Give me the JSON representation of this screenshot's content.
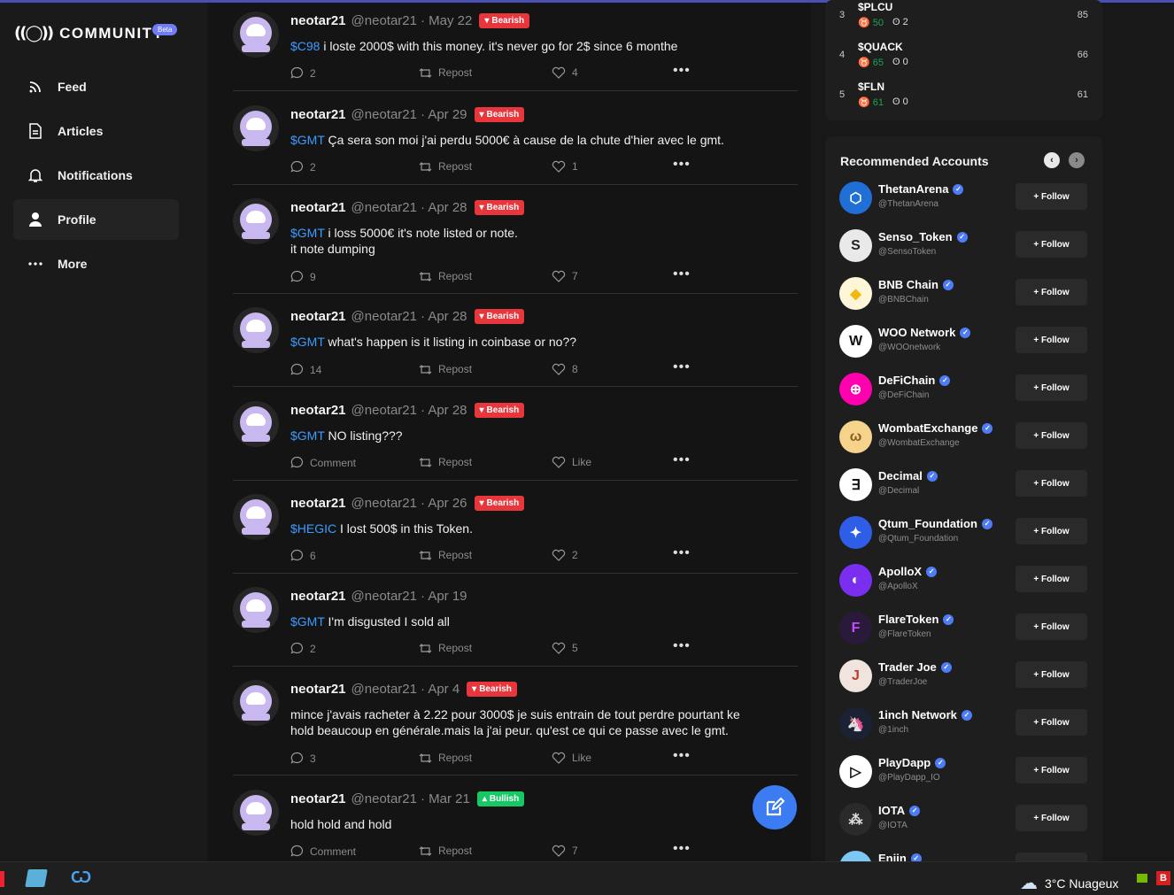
{
  "app": {
    "logo_text": "COMMUNITY",
    "beta_label": "Beta"
  },
  "sidebar": {
    "items": [
      {
        "label": "Feed",
        "icon": "rss-icon"
      },
      {
        "label": "Articles",
        "icon": "document-icon"
      },
      {
        "label": "Notifications",
        "icon": "bell-icon"
      },
      {
        "label": "Profile",
        "icon": "user-icon"
      },
      {
        "label": "More",
        "icon": "more-icon"
      }
    ],
    "active": "Profile"
  },
  "posts": [
    {
      "user": "neotar21",
      "handle": "@neotar21",
      "date": "· May 22",
      "sentiment": "Bearish",
      "ticker": "$C98",
      "text": " i loste 2000$ with this money. it's never go for 2$ since 6 monthe",
      "comments": "2",
      "repost": "Repost",
      "likes": "4"
    },
    {
      "user": "neotar21",
      "handle": "@neotar21",
      "date": "· Apr 29",
      "sentiment": "Bearish",
      "ticker": "$GMT",
      "text": " Ça sera son moi j'ai perdu 5000€ à cause de la chute d'hier avec le gmt.",
      "comments": "2",
      "repost": "Repost",
      "likes": "1"
    },
    {
      "user": "neotar21",
      "handle": "@neotar21",
      "date": "· Apr 28",
      "sentiment": "Bearish",
      "ticker": "$GMT",
      "text": " i loss 5000€ it's note listed or note.",
      "text2": "it note dumping",
      "comments": "9",
      "repost": "Repost",
      "likes": "7"
    },
    {
      "user": "neotar21",
      "handle": "@neotar21",
      "date": "· Apr 28",
      "sentiment": "Bearish",
      "ticker": "$GMT",
      "text": " what's happen is it listing in coinbase or no??",
      "comments": "14",
      "repost": "Repost",
      "likes": "8"
    },
    {
      "user": "neotar21",
      "handle": "@neotar21",
      "date": "· Apr 28",
      "sentiment": "Bearish",
      "ticker": "$GMT",
      "text": " NO listing???",
      "comments": "Comment",
      "repost": "Repost",
      "likes": "Like"
    },
    {
      "user": "neotar21",
      "handle": "@neotar21",
      "date": "· Apr 26",
      "sentiment": "Bearish",
      "ticker": "$HEGIC",
      "text": " I lost 500$ in this Token.",
      "comments": "6",
      "repost": "Repost",
      "likes": "2"
    },
    {
      "user": "neotar21",
      "handle": "@neotar21",
      "date": "· Apr 19",
      "sentiment": "",
      "ticker": "$GMT",
      "text": " I'm disgusted I sold all",
      "comments": "2",
      "repost": "Repost",
      "likes": "5"
    },
    {
      "user": "neotar21",
      "handle": "@neotar21",
      "date": "· Apr 4",
      "sentiment": "Bearish",
      "ticker": "",
      "text": "mince j'avais racheter à 2.22 pour 3000$ je suis entrain de tout perdre pourtant ke",
      "text2": "hold beaucoup en générale.mais la j'ai peur. qu'est ce qui ce passe avec le gmt.",
      "comments": "3",
      "repost": "Repost",
      "likes": "Like"
    },
    {
      "user": "neotar21",
      "handle": "@neotar21",
      "date": "· Mar 21",
      "sentiment": "Bullish",
      "ticker": "",
      "text": "hold hold and hold",
      "comments": "Comment",
      "repost": "Repost",
      "likes": "7"
    }
  ],
  "rankings": [
    {
      "rank": "3",
      "symbol": "$PLCU",
      "bull": "50",
      "bear": "2",
      "score": "85"
    },
    {
      "rank": "4",
      "symbol": "$QUACK",
      "bull": "65",
      "bear": "0",
      "score": "66"
    },
    {
      "rank": "5",
      "symbol": "$FLN",
      "bull": "61",
      "bear": "0",
      "score": "61"
    }
  ],
  "recommended": {
    "title": "Recommended Accounts",
    "follow_label": "+ Follow",
    "accounts": [
      {
        "name": "ThetanArena",
        "handle": "@ThetanArena",
        "color": "#1f6fd6"
      },
      {
        "name": "Senso_Token",
        "handle": "@SensoToken",
        "color": "#e9e9e9"
      },
      {
        "name": "BNB Chain",
        "handle": "@BNBChain",
        "color": "#fff6da"
      },
      {
        "name": "WOO Network",
        "handle": "@WOOnetwork",
        "color": "#ffffff"
      },
      {
        "name": "DeFiChain",
        "handle": "@DeFiChain",
        "color": "#ff00af"
      },
      {
        "name": "WombatExchange",
        "handle": "@WombatExchange",
        "color": "#f6d38a"
      },
      {
        "name": "Decimal",
        "handle": "@Decimal",
        "color": "#ffffff"
      },
      {
        "name": "Qtum_Foundation",
        "handle": "@Qtum_Foundation",
        "color": "#2e5ee8"
      },
      {
        "name": "ApolloX",
        "handle": "@ApolloX",
        "color": "#7a2ff0"
      },
      {
        "name": "FlareToken",
        "handle": "@FlareToken",
        "color": "#2a1a3a"
      },
      {
        "name": "Trader Joe",
        "handle": "@TraderJoe",
        "color": "#f1e4df"
      },
      {
        "name": "1inch Network",
        "handle": "@1inch",
        "color": "#1b2233"
      },
      {
        "name": "PlayDapp",
        "handle": "@PlayDapp_IO",
        "color": "#ffffff"
      },
      {
        "name": "IOTA",
        "handle": "@IOTA",
        "color": "#2a2a2a"
      },
      {
        "name": "Enjin",
        "handle": "",
        "color": "#7cc8f5"
      }
    ]
  },
  "taskbar": {
    "weather": "3°C  Nuageux"
  }
}
